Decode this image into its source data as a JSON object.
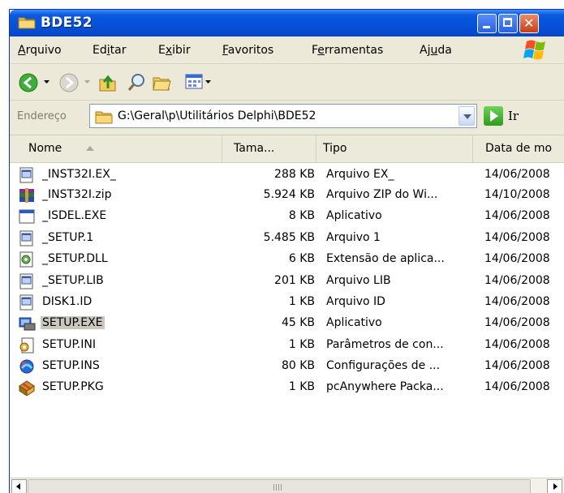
{
  "window": {
    "title": "BDE52",
    "title_icon": "folder-icon"
  },
  "menubar": {
    "items": [
      {
        "pre": "",
        "u": "A",
        "post": "rquivo"
      },
      {
        "pre": "Ed",
        "u": "i",
        "post": "tar"
      },
      {
        "pre": "E",
        "u": "x",
        "post": "ibir"
      },
      {
        "pre": "",
        "u": "F",
        "post": "avoritos"
      },
      {
        "pre": "F",
        "u": "e",
        "post": "rramentas"
      },
      {
        "pre": "Aj",
        "u": "u",
        "post": "da"
      }
    ]
  },
  "toolbar": {
    "icons": [
      "back-icon",
      "dropdown-icon",
      "forward-icon",
      "dropdown-icon",
      "up-folder-icon",
      "search-icon",
      "folders-icon",
      "views-icon",
      "dropdown-icon"
    ]
  },
  "address": {
    "label": "Endereço",
    "path": "G:\\Geral\\p\\Utilitários Delphi\\BDE52",
    "go_label": "Ir"
  },
  "columns": [
    "Nome",
    "Tama...",
    "Tipo",
    "Data de mo"
  ],
  "files": [
    {
      "name": "_INST32I.EX_",
      "size": "288 KB",
      "type": "Arquivo EX_",
      "date": "14/06/2008",
      "icon": "generic-file-icon"
    },
    {
      "name": "_INST32I.zip",
      "size": "5.924 KB",
      "type": "Arquivo ZIP do Wi...",
      "date": "14/10/2008",
      "icon": "winrar-archive-icon"
    },
    {
      "name": "_ISDEL.EXE",
      "size": "8 KB",
      "type": "Aplicativo",
      "date": "14/06/2008",
      "icon": "application-icon"
    },
    {
      "name": "_SETUP.1",
      "size": "5.485 KB",
      "type": "Arquivo 1",
      "date": "14/06/2008",
      "icon": "generic-file-icon"
    },
    {
      "name": "_SETUP.DLL",
      "size": "6 KB",
      "type": "Extensão de aplica...",
      "date": "14/06/2008",
      "icon": "dll-icon"
    },
    {
      "name": "_SETUP.LIB",
      "size": "201 KB",
      "type": "Arquivo LIB",
      "date": "14/06/2008",
      "icon": "generic-file-icon"
    },
    {
      "name": "DISK1.ID",
      "size": "1 KB",
      "type": "Arquivo ID",
      "date": "14/06/2008",
      "icon": "generic-file-icon"
    },
    {
      "name": "SETUP.EXE",
      "size": "45 KB",
      "type": "Aplicativo",
      "date": "14/06/2008",
      "icon": "setup-exe-icon",
      "selected": true
    },
    {
      "name": "SETUP.INI",
      "size": "1 KB",
      "type": "Parâmetros de con...",
      "date": "14/06/2008",
      "icon": "settings-file-icon"
    },
    {
      "name": "SETUP.INS",
      "size": "80 KB",
      "type": "Configurações de ...",
      "date": "14/06/2008",
      "icon": "installshield-icon"
    },
    {
      "name": "SETUP.PKG",
      "size": "1 KB",
      "type": "pcAnywhere Packa...",
      "date": "14/06/2008",
      "icon": "package-icon"
    }
  ],
  "colors": {
    "title_bar": "#0A5AE0",
    "chrome": "#ECE9D8",
    "selection": "#C9C7BE"
  }
}
